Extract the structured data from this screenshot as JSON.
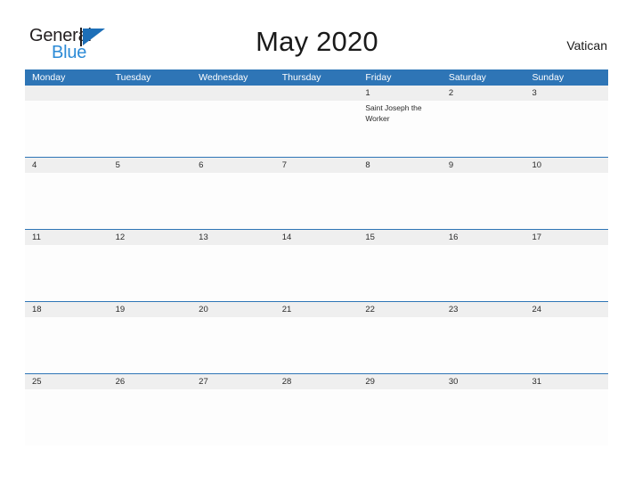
{
  "brand": {
    "line1": "General",
    "line2": "Blue",
    "flag_icon": "triangle-flag-icon",
    "accent_color": "#1d6fb8",
    "text_color": "#231f20",
    "blue_text_color": "#2b8ad6"
  },
  "header": {
    "title": "May 2020",
    "region": "Vatican"
  },
  "theme": {
    "header_blue": "#2e75b6",
    "date_band_gray": "#efefef",
    "row_divider": "#2e75b6",
    "page_bg": "#ffffff"
  },
  "calendar": {
    "weekdays": [
      "Monday",
      "Tuesday",
      "Wednesday",
      "Thursday",
      "Friday",
      "Saturday",
      "Sunday"
    ],
    "weeks": [
      {
        "days": [
          {
            "date": "",
            "events": []
          },
          {
            "date": "",
            "events": []
          },
          {
            "date": "",
            "events": []
          },
          {
            "date": "",
            "events": []
          },
          {
            "date": "1",
            "events": [
              "Saint Joseph the Worker"
            ]
          },
          {
            "date": "2",
            "events": []
          },
          {
            "date": "3",
            "events": []
          }
        ]
      },
      {
        "days": [
          {
            "date": "4",
            "events": []
          },
          {
            "date": "5",
            "events": []
          },
          {
            "date": "6",
            "events": []
          },
          {
            "date": "7",
            "events": []
          },
          {
            "date": "8",
            "events": []
          },
          {
            "date": "9",
            "events": []
          },
          {
            "date": "10",
            "events": []
          }
        ]
      },
      {
        "days": [
          {
            "date": "11",
            "events": []
          },
          {
            "date": "12",
            "events": []
          },
          {
            "date": "13",
            "events": []
          },
          {
            "date": "14",
            "events": []
          },
          {
            "date": "15",
            "events": []
          },
          {
            "date": "16",
            "events": []
          },
          {
            "date": "17",
            "events": []
          }
        ]
      },
      {
        "days": [
          {
            "date": "18",
            "events": []
          },
          {
            "date": "19",
            "events": []
          },
          {
            "date": "20",
            "events": []
          },
          {
            "date": "21",
            "events": []
          },
          {
            "date": "22",
            "events": []
          },
          {
            "date": "23",
            "events": []
          },
          {
            "date": "24",
            "events": []
          }
        ]
      },
      {
        "days": [
          {
            "date": "25",
            "events": []
          },
          {
            "date": "26",
            "events": []
          },
          {
            "date": "27",
            "events": []
          },
          {
            "date": "28",
            "events": []
          },
          {
            "date": "29",
            "events": []
          },
          {
            "date": "30",
            "events": []
          },
          {
            "date": "31",
            "events": []
          }
        ]
      }
    ]
  }
}
